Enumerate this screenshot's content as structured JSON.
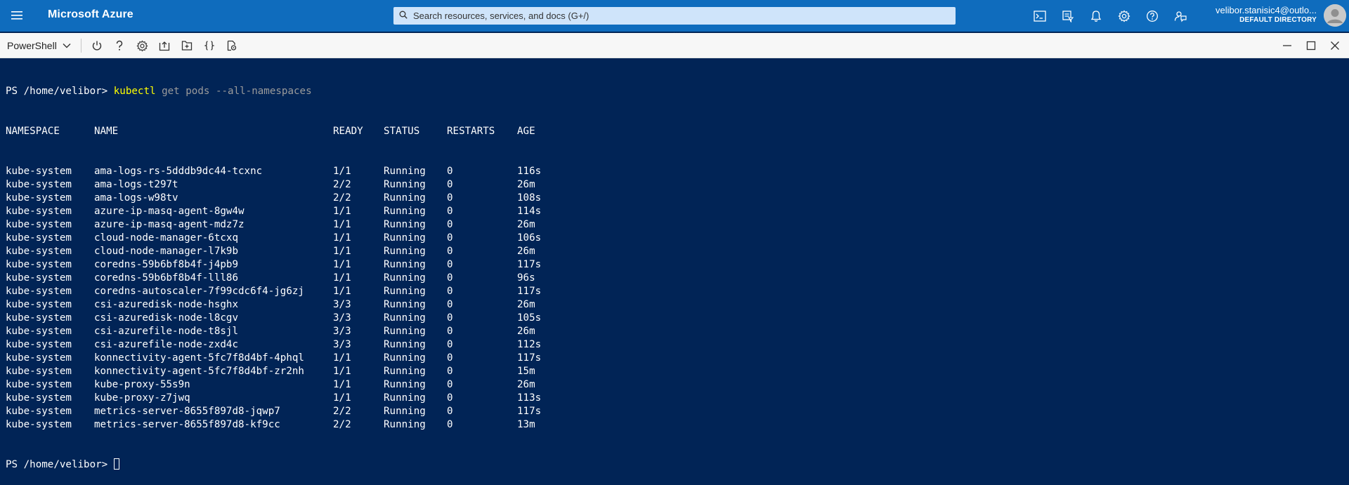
{
  "header": {
    "brand": "Microsoft Azure",
    "search_placeholder": "Search resources, services, and docs (G+/)",
    "account_email": "velibor.stanisic4@outlo...",
    "account_directory": "DEFAULT DIRECTORY",
    "icons": [
      "cloud-shell-icon",
      "directory-filter-icon",
      "notifications-icon",
      "settings-icon",
      "help-icon",
      "feedback-icon"
    ]
  },
  "shell": {
    "type_label": "PowerShell",
    "resize_handle": "...",
    "toolbar_icons": [
      "power-icon",
      "help-icon",
      "settings-icon",
      "upload-download-icon",
      "open-new-session-icon",
      "editor-icon",
      "web-preview-icon"
    ]
  },
  "terminal": {
    "prompt": "PS /home/velibor>",
    "command": "kubectl",
    "command_args": " get pods --all-namespaces",
    "headers": [
      "NAMESPACE",
      "NAME",
      "READY",
      "STATUS",
      "RESTARTS",
      "AGE"
    ],
    "rows": [
      [
        "kube-system",
        "ama-logs-rs-5dddb9dc44-tcxnc",
        "1/1",
        "Running",
        "0",
        "116s"
      ],
      [
        "kube-system",
        "ama-logs-t297t",
        "2/2",
        "Running",
        "0",
        "26m"
      ],
      [
        "kube-system",
        "ama-logs-w98tv",
        "2/2",
        "Running",
        "0",
        "108s"
      ],
      [
        "kube-system",
        "azure-ip-masq-agent-8gw4w",
        "1/1",
        "Running",
        "0",
        "114s"
      ],
      [
        "kube-system",
        "azure-ip-masq-agent-mdz7z",
        "1/1",
        "Running",
        "0",
        "26m"
      ],
      [
        "kube-system",
        "cloud-node-manager-6tcxq",
        "1/1",
        "Running",
        "0",
        "106s"
      ],
      [
        "kube-system",
        "cloud-node-manager-l7k9b",
        "1/1",
        "Running",
        "0",
        "26m"
      ],
      [
        "kube-system",
        "coredns-59b6bf8b4f-j4pb9",
        "1/1",
        "Running",
        "0",
        "117s"
      ],
      [
        "kube-system",
        "coredns-59b6bf8b4f-lll86",
        "1/1",
        "Running",
        "0",
        "96s"
      ],
      [
        "kube-system",
        "coredns-autoscaler-7f99cdc6f4-jg6zj",
        "1/1",
        "Running",
        "0",
        "117s"
      ],
      [
        "kube-system",
        "csi-azuredisk-node-hsghx",
        "3/3",
        "Running",
        "0",
        "26m"
      ],
      [
        "kube-system",
        "csi-azuredisk-node-l8cgv",
        "3/3",
        "Running",
        "0",
        "105s"
      ],
      [
        "kube-system",
        "csi-azurefile-node-t8sjl",
        "3/3",
        "Running",
        "0",
        "26m"
      ],
      [
        "kube-system",
        "csi-azurefile-node-zxd4c",
        "3/3",
        "Running",
        "0",
        "112s"
      ],
      [
        "kube-system",
        "konnectivity-agent-5fc7f8d4bf-4phql",
        "1/1",
        "Running",
        "0",
        "117s"
      ],
      [
        "kube-system",
        "konnectivity-agent-5fc7f8d4bf-zr2nh",
        "1/1",
        "Running",
        "0",
        "15m"
      ],
      [
        "kube-system",
        "kube-proxy-55s9n",
        "1/1",
        "Running",
        "0",
        "26m"
      ],
      [
        "kube-system",
        "kube-proxy-z7jwq",
        "1/1",
        "Running",
        "0",
        "113s"
      ],
      [
        "kube-system",
        "metrics-server-8655f897d8-jqwp7",
        "2/2",
        "Running",
        "0",
        "117s"
      ],
      [
        "kube-system",
        "metrics-server-8655f897d8-kf9cc",
        "2/2",
        "Running",
        "0",
        "13m"
      ]
    ],
    "final_prompt": "PS /home/velibor>"
  }
}
